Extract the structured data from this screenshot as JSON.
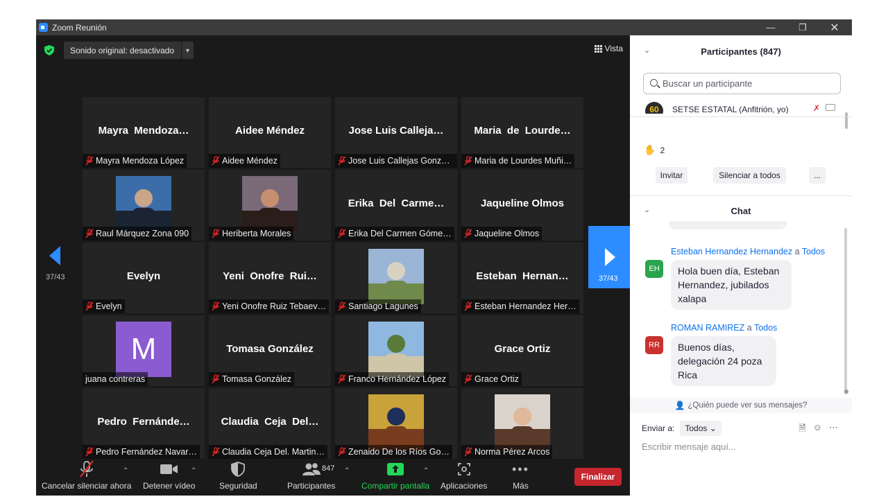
{
  "window": {
    "title": "Zoom Reunión"
  },
  "stage": {
    "sound_button": "Sonido original: desactivado",
    "view_button": "Vista",
    "page_indicator_left": "37/43",
    "page_indicator_right": "37/43"
  },
  "tiles": [
    {
      "big": "Mayra  Mendoza…",
      "label": "Mayra Mendoza López",
      "muted": true
    },
    {
      "big": "Aidee Méndez",
      "label": "Aidee Méndez",
      "muted": true
    },
    {
      "big": "Jose Luis Calleja…",
      "label": "Jose Luis Callejas Gonza…",
      "muted": true
    },
    {
      "big": "Maria  de  Lourde…",
      "label": "Maria de Lourdes Muñi…",
      "muted": true
    },
    {
      "big": "",
      "label": "Raul Márquez Zona 090",
      "muted": true,
      "photo": "photo-man-sunglasses"
    },
    {
      "big": "",
      "label": "Heriberta Morales",
      "muted": true,
      "photo": "photo-woman"
    },
    {
      "big": "Erika  Del  Carme…",
      "label": "Erika Del Carmen Góme…",
      "muted": true
    },
    {
      "big": "Jaqueline Olmos",
      "label": "Jaqueline Olmos",
      "muted": true
    },
    {
      "big": "Evelyn",
      "label": "Evelyn",
      "muted": true
    },
    {
      "big": "Yeni  Onofre  Rui…",
      "label": "Yeni Onofre Ruiz Tebaev…",
      "muted": true
    },
    {
      "big": "",
      "label": "Santiago Lagunes",
      "muted": true,
      "photo": "photo-man-outdoor"
    },
    {
      "big": "Esteban  Hernan…",
      "label": "Esteban Hernandez Her…",
      "muted": true
    },
    {
      "big": "",
      "label": "juana contreras",
      "muted": false,
      "avatar_letter": "M"
    },
    {
      "big": "Tomasa González",
      "label": "Tomasa González",
      "muted": true
    },
    {
      "big": "",
      "label": "Franco Hernández López",
      "muted": true,
      "photo": "photo-church"
    },
    {
      "big": "Grace Ortiz",
      "label": "Grace Ortiz",
      "muted": true
    },
    {
      "big": "Pedro  Fernánde…",
      "label": "Pedro Fernández Navar…",
      "muted": true
    },
    {
      "big": "Claudia  Ceja  Del…",
      "label": "Claudia Ceja Del. Martin…",
      "muted": true
    },
    {
      "big": "",
      "label": "Zenaido De los Ríos Go…",
      "muted": true,
      "photo": "photo-icon"
    },
    {
      "big": "",
      "label": "Norma Pérez Arcos",
      "muted": true,
      "photo": "photo-woman-child"
    }
  ],
  "toolbar": {
    "unmute": "Cancelar silenciar ahora",
    "video": "Detener vídeo",
    "security": "Seguridad",
    "participants": "Participantes",
    "participants_count": "847",
    "share": "Compartir pantalla",
    "apps": "Aplicaciones",
    "more": "Más",
    "end": "Finalizar"
  },
  "participants_panel": {
    "title": "Participantes (847)",
    "search_placeholder": "Buscar un participante",
    "host_avatar": "60",
    "host_name": "SETSE ESTATAL (Anfitrión, yo)",
    "raised_hands": "2",
    "invite": "Invitar",
    "mute_all": "Silenciar a todos",
    "more": "..."
  },
  "chat": {
    "title": "Chat",
    "messages": [
      {
        "sender": "Esteban Hernandez Hernandez",
        "a": "a",
        "to": "Todos",
        "initials": "EH",
        "color": "#2aa44f",
        "text": "Hola buen día, Esteban Hernandez, jubilados xalapa"
      },
      {
        "sender": "ROMAN RAMIREZ",
        "a": "a",
        "to": "Todos",
        "initials": "RR",
        "color": "#c9322e",
        "text": "Buenos días, delegación 24 poza Rica"
      }
    ],
    "who_can_see": "¿Quién puede ver sus mensajes?",
    "send_to_label": "Enviar a:",
    "send_to_value": "Todos",
    "input_placeholder": "Escribir mensaje aquí..."
  }
}
